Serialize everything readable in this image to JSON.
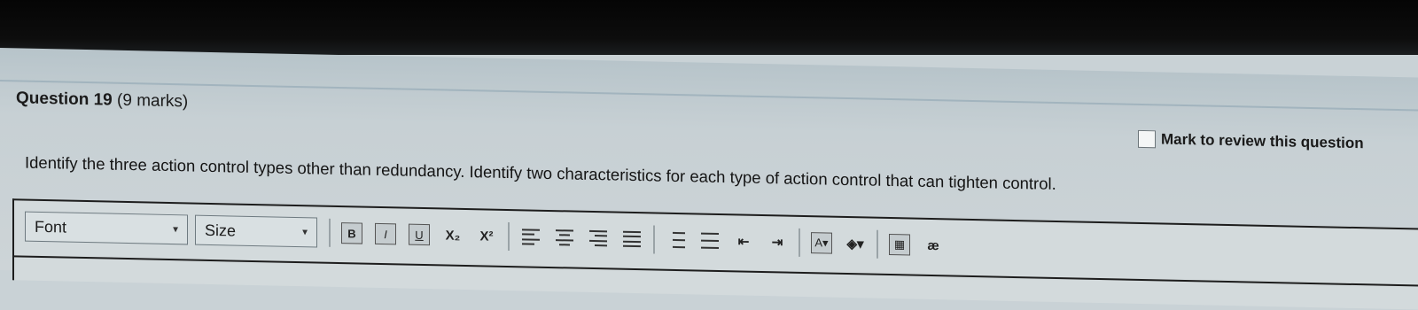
{
  "question": {
    "number_label": "Question 19",
    "marks_label": "(9 marks)",
    "text": "Identify the three action control types other than redundancy. Identify two characteristics for each type of action control that can tighten control."
  },
  "review": {
    "label": "Mark to review this question"
  },
  "toolbar": {
    "font_select": "Font",
    "size_select": "Size",
    "bold": "B",
    "italic": "I",
    "underline": "U",
    "subscript": "X₂",
    "superscript": "X²",
    "special_char": "æ"
  }
}
